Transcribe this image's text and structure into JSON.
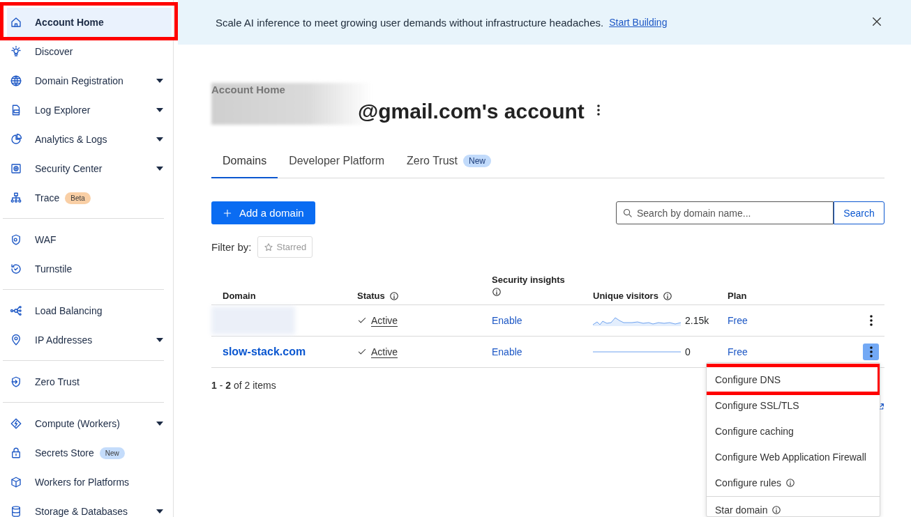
{
  "sidebar": {
    "groups": [
      [
        {
          "label": "Account Home",
          "selected": true,
          "highlighted": true,
          "expandable": false
        },
        {
          "label": "Discover",
          "selected": false,
          "highlighted": false,
          "expandable": false
        },
        {
          "label": "Domain Registration",
          "selected": false,
          "highlighted": false,
          "expandable": true
        },
        {
          "label": "Log Explorer",
          "selected": false,
          "highlighted": false,
          "expandable": true
        },
        {
          "label": "Analytics & Logs",
          "selected": false,
          "highlighted": false,
          "expandable": true
        },
        {
          "label": "Security Center",
          "selected": false,
          "highlighted": false,
          "expandable": true
        },
        {
          "label": "Trace",
          "selected": false,
          "highlighted": false,
          "expandable": false,
          "badge": "Beta",
          "color": "#f9cfa5"
        }
      ],
      [
        {
          "label": "WAF",
          "selected": false,
          "highlighted": false,
          "expandable": false
        },
        {
          "label": "Turnstile",
          "selected": false,
          "highlighted": false,
          "expandable": false
        }
      ],
      [
        {
          "label": "Load Balancing",
          "selected": false,
          "highlighted": false,
          "expandable": false
        },
        {
          "label": "IP Addresses",
          "selected": false,
          "highlighted": false,
          "expandable": true
        }
      ],
      [
        {
          "label": "Zero Trust",
          "selected": false,
          "highlighted": false,
          "expandable": false
        }
      ],
      [
        {
          "label": "Compute (Workers)",
          "selected": false,
          "highlighted": false,
          "expandable": true
        },
        {
          "label": "Secrets Store",
          "selected": false,
          "highlighted": false,
          "expandable": false,
          "badge": "New",
          "color": "#c4dcfb"
        },
        {
          "label": "Workers for Platforms",
          "selected": false,
          "highlighted": false,
          "expandable": false
        },
        {
          "label": "Storage & Databases",
          "selected": false,
          "highlighted": false,
          "expandable": true
        }
      ]
    ]
  },
  "banner": {
    "message": "Scale AI inference to meet growing user demands without infrastructure headaches.",
    "link": "Start Building"
  },
  "header": {
    "breadcrumb": "Account Home",
    "title": "@gmail.com's account",
    "redacted": true
  },
  "tabs": [
    {
      "label": "Domains",
      "selected": true
    },
    {
      "label": "Developer Platform",
      "selected": false
    },
    {
      "label": "Zero Trust",
      "selected": false,
      "badge": "New"
    }
  ],
  "add_button": "Add a domain",
  "search": {
    "placeholder": "Search by domain name...",
    "button": "Search"
  },
  "filter": {
    "label": "Filter by:",
    "starred": {
      "label": "Starred",
      "selected": false
    }
  },
  "table": {
    "columns": [
      {
        "label": "Domain",
        "info": false
      },
      {
        "label": "Status",
        "info": true
      },
      {
        "label": "Security insights",
        "info": true
      },
      {
        "label": "Unique visitors",
        "info": true
      },
      {
        "label": "Plan",
        "info": false
      }
    ],
    "rows": [
      {
        "redacted": true,
        "status": "Active",
        "insights": "Enable",
        "visitors": "2.15k",
        "plan": "Free",
        "menu_open": false
      },
      {
        "domain": "slow-stack.com",
        "redacted": false,
        "status": "Active",
        "insights": "Enable",
        "visitors": "0",
        "plan": "Free",
        "menu_open": true
      }
    ]
  },
  "pagination": "**1** - **2** of 2 items",
  "row_menu": {
    "items": [
      {
        "label": "Configure DNS",
        "info": false,
        "highlighted": true,
        "divider_before": false
      },
      {
        "label": "Configure SSL/TLS",
        "info": false,
        "highlighted": false,
        "divider_before": false
      },
      {
        "label": "Configure caching",
        "info": false,
        "highlighted": false,
        "divider_before": false
      },
      {
        "label": "Configure Web Application Firewall",
        "info": false,
        "highlighted": false,
        "divider_before": false
      },
      {
        "label": "Configure rules",
        "info": true,
        "highlighted": false,
        "divider_before": false
      },
      {
        "label": "Star domain",
        "info": true,
        "highlighted": false,
        "divider_before": true
      }
    ]
  }
}
